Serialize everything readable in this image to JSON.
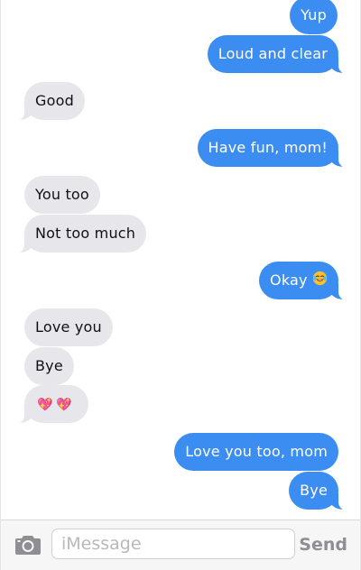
{
  "messages": [
    {
      "from": "me",
      "text": "Yup"
    },
    {
      "from": "me",
      "text": "Loud and clear"
    },
    {
      "from": "them",
      "text": "Good"
    },
    {
      "from": "me",
      "text": "Have fun, mom!"
    },
    {
      "from": "them",
      "text": "You too"
    },
    {
      "from": "them",
      "text": "Not too much"
    },
    {
      "from": "me",
      "text": "Okay",
      "emoji": "laughing-with-tears-emoji"
    },
    {
      "from": "them",
      "text": "Love you"
    },
    {
      "from": "them",
      "text": "Bye"
    },
    {
      "from": "them",
      "text": "💖💖",
      "emoji": "sparkling-heart-emoji"
    },
    {
      "from": "me",
      "text": "Love you too, mom"
    },
    {
      "from": "me",
      "text": "Bye"
    }
  ],
  "composer": {
    "placeholder": "iMessage",
    "value": "",
    "send_label": "Send",
    "camera_icon": "camera-icon"
  },
  "colors": {
    "outgoing_bubble": "#3b8df2",
    "incoming_bubble": "#e7e6eb",
    "send_text": "#8e8e93"
  }
}
